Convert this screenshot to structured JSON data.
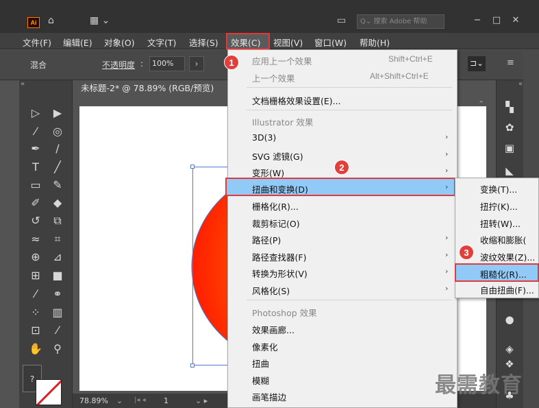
{
  "titlebar": {
    "logo": "Ai",
    "search_placeholder": "搜索 Adobe 帮助",
    "icons": [
      "home-icon",
      "workspace-icon",
      "panel-icon",
      "minimize-icon",
      "maximize-icon",
      "close-icon"
    ]
  },
  "menubar": {
    "items": [
      "文件(F)",
      "编辑(E)",
      "对象(O)",
      "文字(T)",
      "选择(S)",
      "效果(C)",
      "视图(V)",
      "窗口(W)",
      "帮助(H)"
    ]
  },
  "options": {
    "blend_label": "混合",
    "opacity_label": "不透明度",
    "opacity_value": "100%"
  },
  "document": {
    "tab_title": "未标题-2* @ 78.89% (RGB/预览)",
    "zoom": "78.89%",
    "page": "1"
  },
  "effect_menu": {
    "apply_last": "应用上一个效果",
    "apply_last_shortcut": "Shift+Ctrl+E",
    "last_effect": "上一个效果",
    "last_effect_shortcut": "Alt+Shift+Ctrl+E",
    "raster_settings": "文档栅格效果设置(E)...",
    "illustrator_header": "Illustrator 效果",
    "illustrator_items": [
      "3D(3)",
      "SVG 滤镜(G)",
      "变形(W)",
      "扭曲和变换(D)",
      "栅格化(R)...",
      "裁剪标记(O)",
      "路径(P)",
      "路径查找器(F)",
      "转换为形状(V)",
      "风格化(S)"
    ],
    "photoshop_header": "Photoshop 效果",
    "photoshop_items": [
      "效果画廊...",
      "像素化",
      "扭曲",
      "模糊",
      "画笔描边"
    ]
  },
  "submenu": {
    "items": [
      "变换(T)...",
      "扭拧(K)...",
      "扭转(W)...",
      "收缩和膨胀(",
      "波纹效果(Z)...",
      "粗糙化(R)...",
      "自由扭曲(F)..."
    ]
  },
  "annotations": {
    "step1": "1",
    "step2": "2",
    "step3": "3"
  },
  "watermark": "最需教育",
  "colors": {
    "highlight": "#91c9f7",
    "annotation_red": "#e23a3a",
    "circle_fill_start": "#ff2a00",
    "circle_fill_end": "#ffd000"
  }
}
